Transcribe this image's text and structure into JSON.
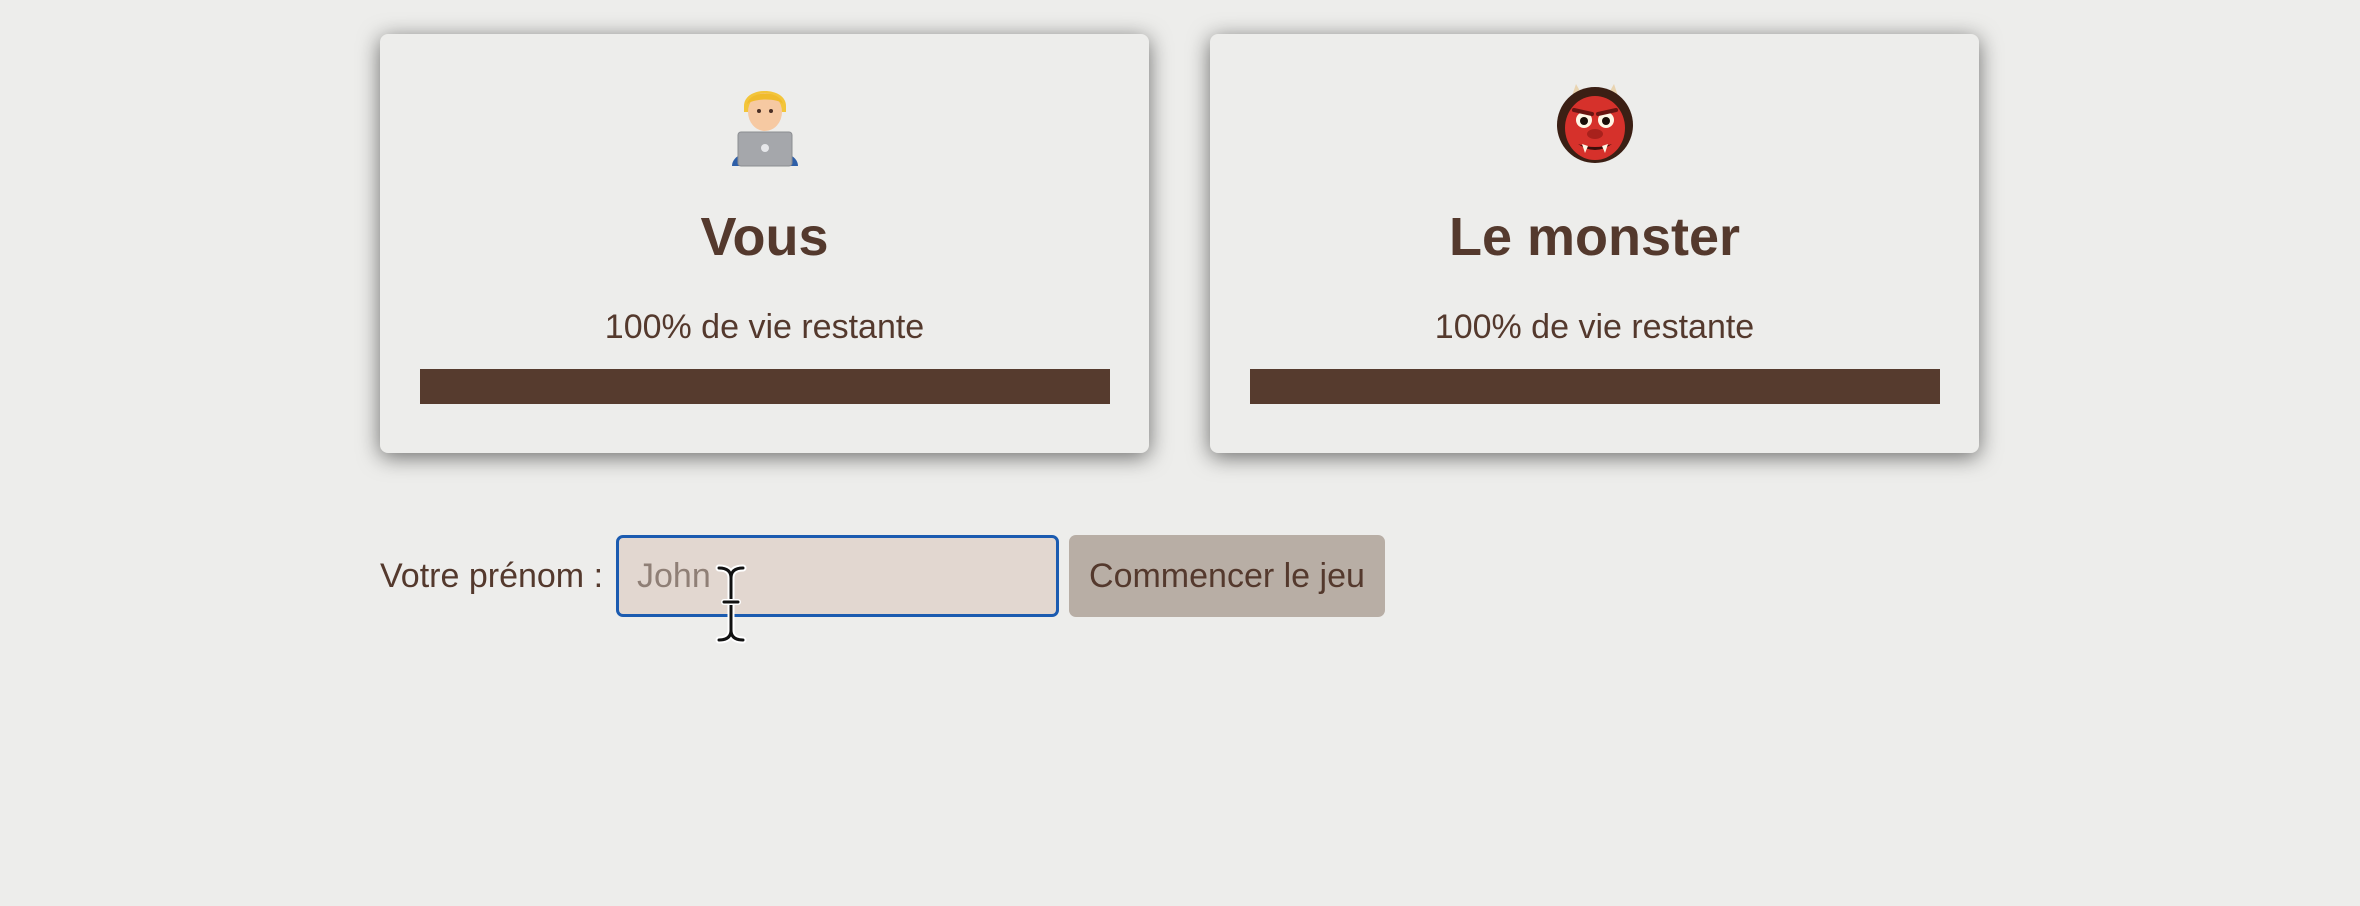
{
  "player": {
    "title": "Vous",
    "life_text": "100% de vie restante",
    "life_percent": 100,
    "avatar_icon": "technologist-emoji-icon"
  },
  "monster": {
    "title": "Le monster",
    "life_text": "100% de vie restante",
    "life_percent": 100,
    "avatar_icon": "ogre-emoji-icon"
  },
  "form": {
    "label": "Votre prénom :",
    "input_placeholder": "John",
    "input_value": "",
    "start_button_label": "Commencer le jeu"
  },
  "colors": {
    "text_brown": "#54392d",
    "bar_fill": "#563b2e",
    "background": "#ededeb",
    "input_bg": "#e2d7d0",
    "input_focus_border": "#1b5bb0",
    "button_bg": "#b8aea5"
  }
}
